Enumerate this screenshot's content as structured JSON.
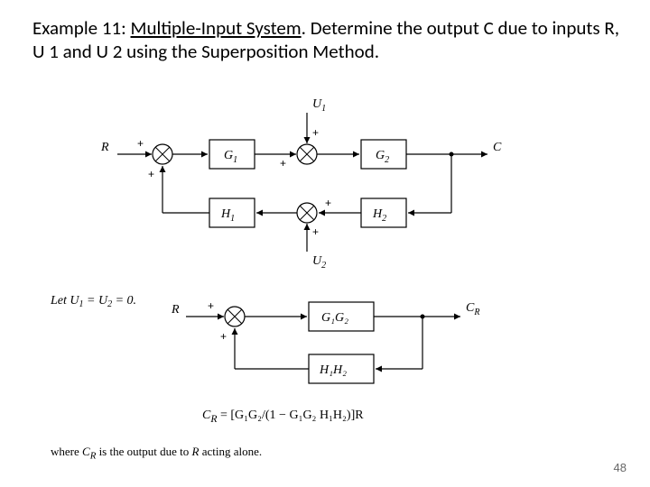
{
  "heading": {
    "prefix": "Example 11: ",
    "underlined": "Multiple-Input System",
    "suffix": ". Determine the output C due to inputs R, U 1 and U 2 using the Superposition Method."
  },
  "diagram1": {
    "R": "R",
    "U1": "U",
    "U1_sub": "1",
    "U2": "U",
    "U2_sub": "2",
    "C": "C",
    "G1": "G",
    "G1_sub": "1",
    "G2": "G",
    "G2_sub": "2",
    "H1": "H",
    "H1_sub": "1",
    "H2": "H",
    "H2_sub": "2",
    "plus": "+"
  },
  "assumption": {
    "text_a": "Let ",
    "U1": "U",
    "s1": "1",
    "eq": " = ",
    "U2": "U",
    "s2": "2",
    "end": " = 0."
  },
  "diagram2": {
    "R": "R",
    "CR": "C",
    "CR_sub": "R",
    "G1G2": "G₁G₂",
    "H1H2": "H₁H₂",
    "plus": "+"
  },
  "equation": "Cᴿ = [G₁G₂ / (1 − G₁G₂ H₁H₂)] R",
  "equation_pretty": {
    "lhs": "C",
    "lhs_sub": "R",
    "rhs": " = [G₁G₂/(1 − G₁G₂ H₁H₂)]R"
  },
  "footnote": {
    "a": "where ",
    "CR": "C",
    "CR_sub": "R",
    "b": " is the output due to ",
    "R": "R",
    "c": " acting alone."
  },
  "page": "48"
}
